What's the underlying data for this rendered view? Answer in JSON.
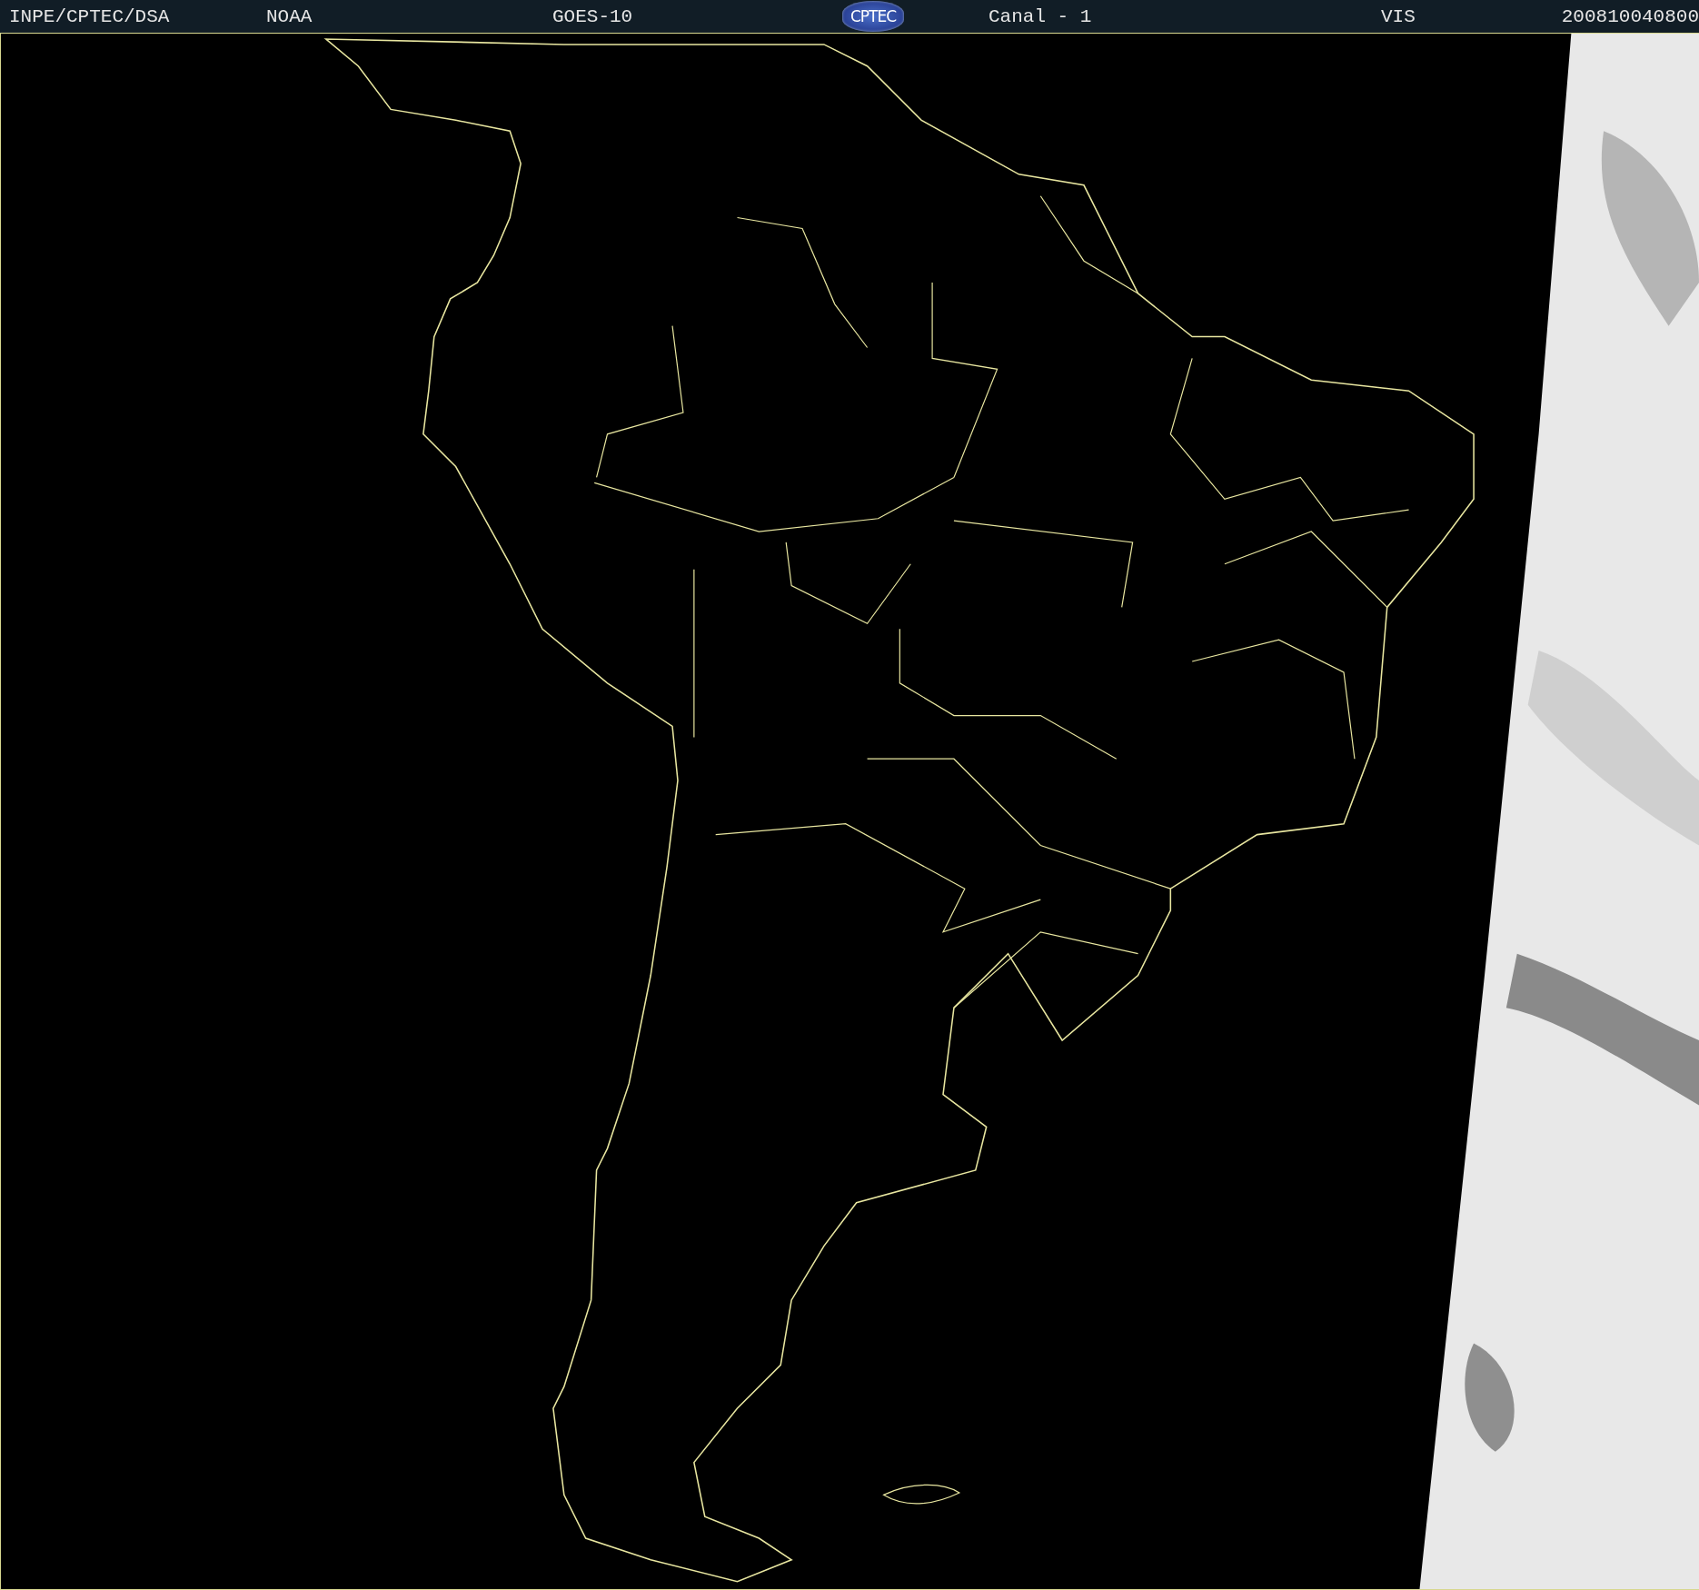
{
  "header": {
    "items": [
      {
        "kind": "text",
        "text": "INPE/CPTEC/DSA"
      },
      {
        "kind": "text",
        "text": "NOAA"
      },
      {
        "kind": "text",
        "text": "GOES-10"
      },
      {
        "kind": "logo",
        "text": "CPTEC"
      },
      {
        "kind": "text",
        "text": "Canal - 1"
      },
      {
        "kind": "text",
        "text": "VIS"
      },
      {
        "kind": "text",
        "text": "200810040800"
      }
    ]
  }
}
